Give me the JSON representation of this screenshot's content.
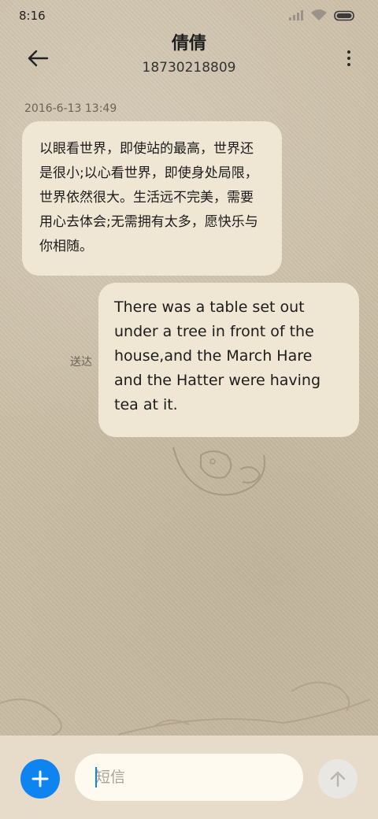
{
  "status_bar": {
    "time": "8:16",
    "icons": [
      "signal-icon",
      "wifi-icon",
      "battery-icon"
    ]
  },
  "header": {
    "contact_name": "倩倩",
    "contact_number": "18730218809",
    "back_icon": "arrow-left-icon",
    "menu_icon": "more-vertical-icon"
  },
  "conversation": {
    "timestamp": "2016-6-13 13:49",
    "messages": [
      {
        "direction": "incoming",
        "text": "以眼看世界，即使站的最高，世界还是很小;以心看世界，即使身处局限，世界依然很大。生活远不完美，需要用心去体会;无需拥有太多，愿快乐与你相随。"
      },
      {
        "direction": "outgoing",
        "text": "There was a table set out under a tree in front of the house,and the March Hare and the Hatter were having tea at it.",
        "status": "送达"
      }
    ]
  },
  "composer": {
    "placeholder": "短信",
    "value": "",
    "add_icon": "plus-icon",
    "send_icon": "arrow-up-icon"
  },
  "colors": {
    "accent": "#0d84f0",
    "bubble": "#efe6d4",
    "background": "#cbbfa8",
    "composer_bg": "#e6dcc9"
  }
}
